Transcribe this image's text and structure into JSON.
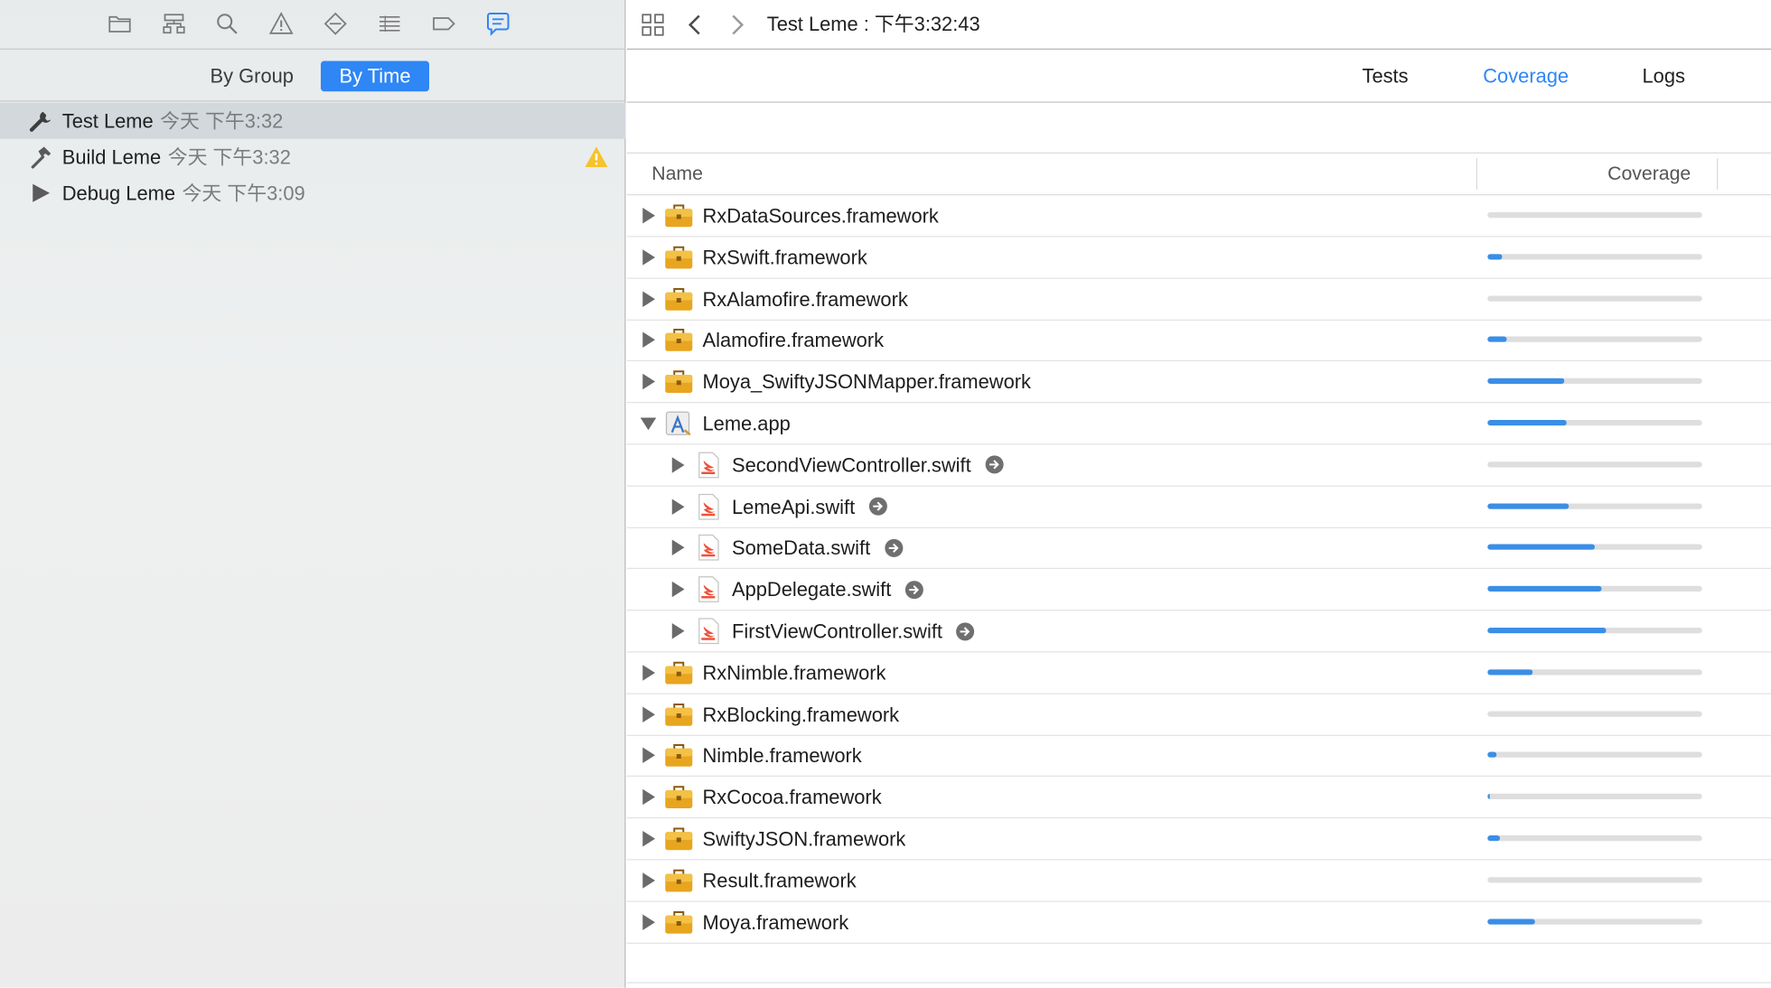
{
  "navigator": {
    "toolbar_icons": [
      "folder-icon",
      "hierarchy-icon",
      "search-icon",
      "warning-icon",
      "diamond-icon",
      "list-icon",
      "tag-icon",
      "report-bubble-icon"
    ],
    "active_icon": "report-bubble-icon",
    "segment": {
      "by_group": "By Group",
      "by_time": "By Time",
      "active": "by_time"
    },
    "activities": [
      {
        "icon": "wrench-icon",
        "name": "Test Leme",
        "time": "今天 下午3:32",
        "selected": true,
        "warning": false
      },
      {
        "icon": "hammer-icon",
        "name": "Build Leme",
        "time": "今天 下午3:32",
        "selected": false,
        "warning": true
      },
      {
        "icon": "play-icon",
        "name": "Debug Leme",
        "time": "今天 下午3:09",
        "selected": false,
        "warning": false
      }
    ]
  },
  "jump_bar": {
    "title": "Test Leme : 下午3:32:43",
    "icons": [
      "grid-icon",
      "back-chevron-icon",
      "forward-chevron-icon"
    ]
  },
  "tabs": {
    "tests": "Tests",
    "coverage": "Coverage",
    "logs": "Logs",
    "active": "coverage"
  },
  "table": {
    "col_name": "Name",
    "col_coverage": "Coverage",
    "rows": [
      {
        "name": "RxDataSources.framework",
        "kind": "framework",
        "level": 0,
        "expanded": false,
        "coverage": 0.0
      },
      {
        "name": "RxSwift.framework",
        "kind": "framework",
        "level": 0,
        "expanded": false,
        "coverage": 0.07
      },
      {
        "name": "RxAlamofire.framework",
        "kind": "framework",
        "level": 0,
        "expanded": false,
        "coverage": 0.0
      },
      {
        "name": "Alamofire.framework",
        "kind": "framework",
        "level": 0,
        "expanded": false,
        "coverage": 0.09
      },
      {
        "name": "Moya_SwiftyJSONMapper.framework",
        "kind": "framework",
        "level": 0,
        "expanded": false,
        "coverage": 0.36
      },
      {
        "name": "Leme.app",
        "kind": "app",
        "level": 0,
        "expanded": true,
        "coverage": 0.37
      },
      {
        "name": "SecondViewController.swift",
        "kind": "swift",
        "level": 1,
        "expanded": false,
        "coverage": 0.0
      },
      {
        "name": "LemeApi.swift",
        "kind": "swift",
        "level": 1,
        "expanded": false,
        "coverage": 0.38
      },
      {
        "name": "SomeData.swift",
        "kind": "swift",
        "level": 1,
        "expanded": false,
        "coverage": 0.5
      },
      {
        "name": "AppDelegate.swift",
        "kind": "swift",
        "level": 1,
        "expanded": false,
        "coverage": 0.53
      },
      {
        "name": "FirstViewController.swift",
        "kind": "swift",
        "level": 1,
        "expanded": false,
        "coverage": 0.55
      },
      {
        "name": "RxNimble.framework",
        "kind": "framework",
        "level": 0,
        "expanded": false,
        "coverage": 0.21
      },
      {
        "name": "RxBlocking.framework",
        "kind": "framework",
        "level": 0,
        "expanded": false,
        "coverage": 0.0
      },
      {
        "name": "Nimble.framework",
        "kind": "framework",
        "level": 0,
        "expanded": false,
        "coverage": 0.04
      },
      {
        "name": "RxCocoa.framework",
        "kind": "framework",
        "level": 0,
        "expanded": false,
        "coverage": 0.01
      },
      {
        "name": "SwiftyJSON.framework",
        "kind": "framework",
        "level": 0,
        "expanded": false,
        "coverage": 0.06
      },
      {
        "name": "Result.framework",
        "kind": "framework",
        "level": 0,
        "expanded": false,
        "coverage": 0.0
      },
      {
        "name": "Moya.framework",
        "kind": "framework",
        "level": 0,
        "expanded": false,
        "coverage": 0.22
      }
    ]
  },
  "colors": {
    "accent": "#2f86f5",
    "coverage_bar": "#3a8ee6",
    "warning": "#f5c32c"
  }
}
